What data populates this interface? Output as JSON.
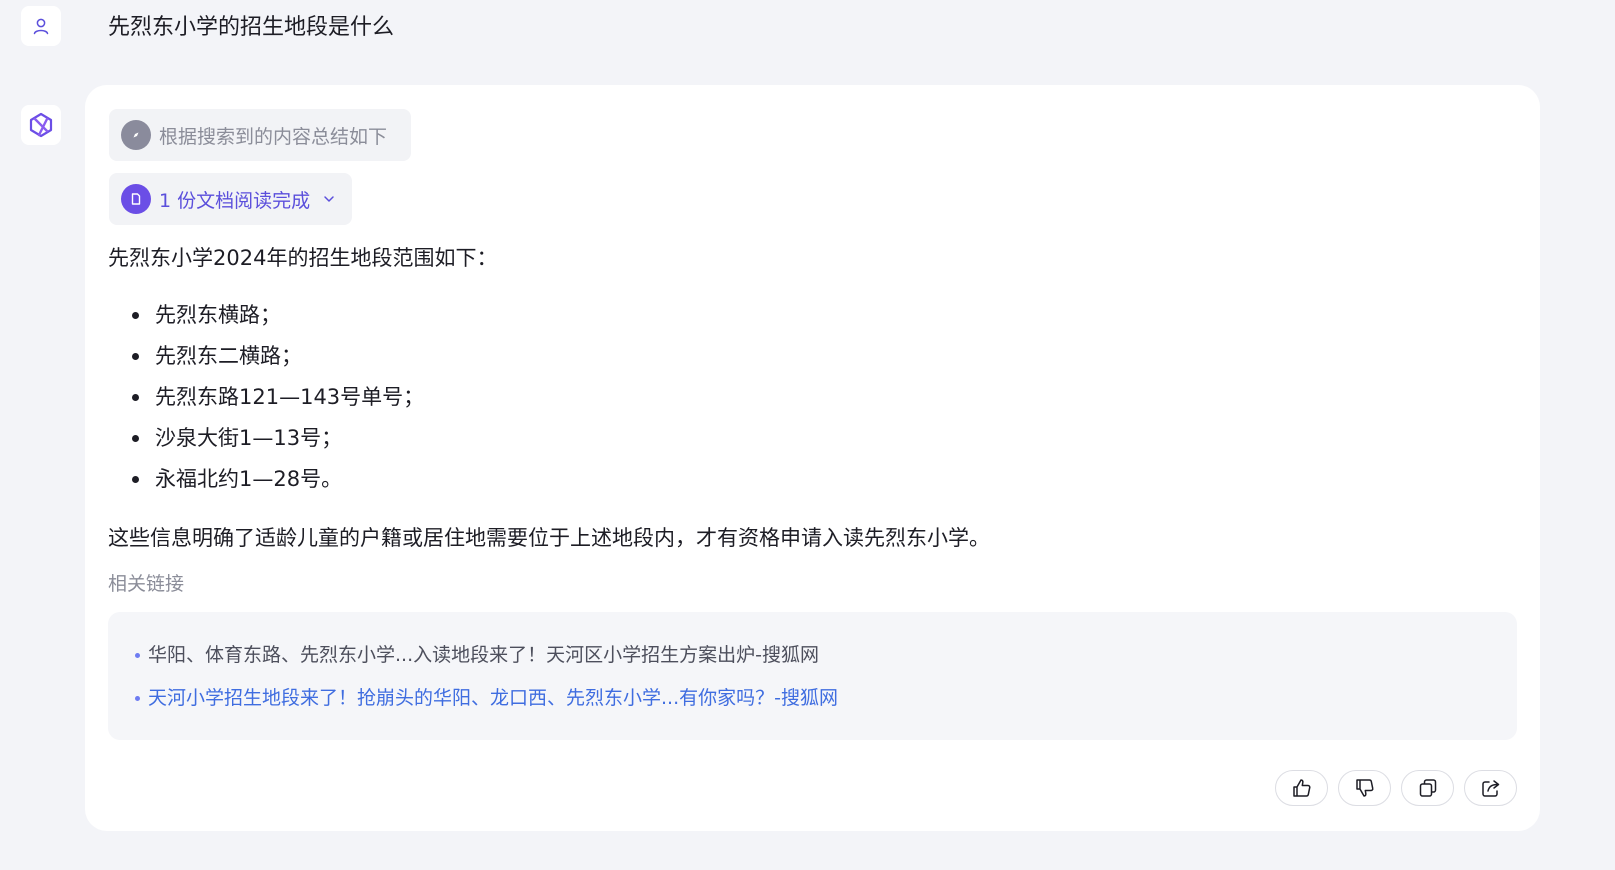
{
  "conversation": {
    "user_question": "先烈东小学的招生地段是什么"
  },
  "answer": {
    "search_summary": "根据搜索到的内容总结如下",
    "documents_read": "1 份文档阅读完成",
    "intro": "先烈东小学2024年的招生地段范围如下：",
    "items": [
      "先烈东横路；",
      "先烈东二横路；",
      "先烈东路121—143号单号；",
      "沙泉大街1—13号；",
      "永福北约1—28号。"
    ],
    "conclusion": "这些信息明确了适龄儿童的户籍或居住地需要位于上述地段内，才有资格申请入读先烈东小学。",
    "related_title": "相关链接",
    "links": [
      "华阳、体育东路、先烈东小学...入读地段来了！天河区小学招生方案出炉-搜狐网",
      "天河小学招生地段来了！抢崩头的华阳、龙口西、先烈东小学...有你家吗？-搜狐网"
    ]
  },
  "icons": {
    "user_avatar": "user-icon",
    "bot_avatar": "assistant-logo-icon",
    "search_chip": "compass-icon",
    "doc_chip": "document-icon",
    "expand": "chevron-down-icon",
    "actions": [
      "thumbs-up-icon",
      "thumbs-down-icon",
      "copy-icon",
      "share-icon"
    ]
  },
  "colors": {
    "background": "#f3f4f8",
    "card": "#ffffff",
    "accent_purple": "#6b4ee6",
    "link_blue": "#3f6de0",
    "muted_text": "#8b8d99"
  }
}
